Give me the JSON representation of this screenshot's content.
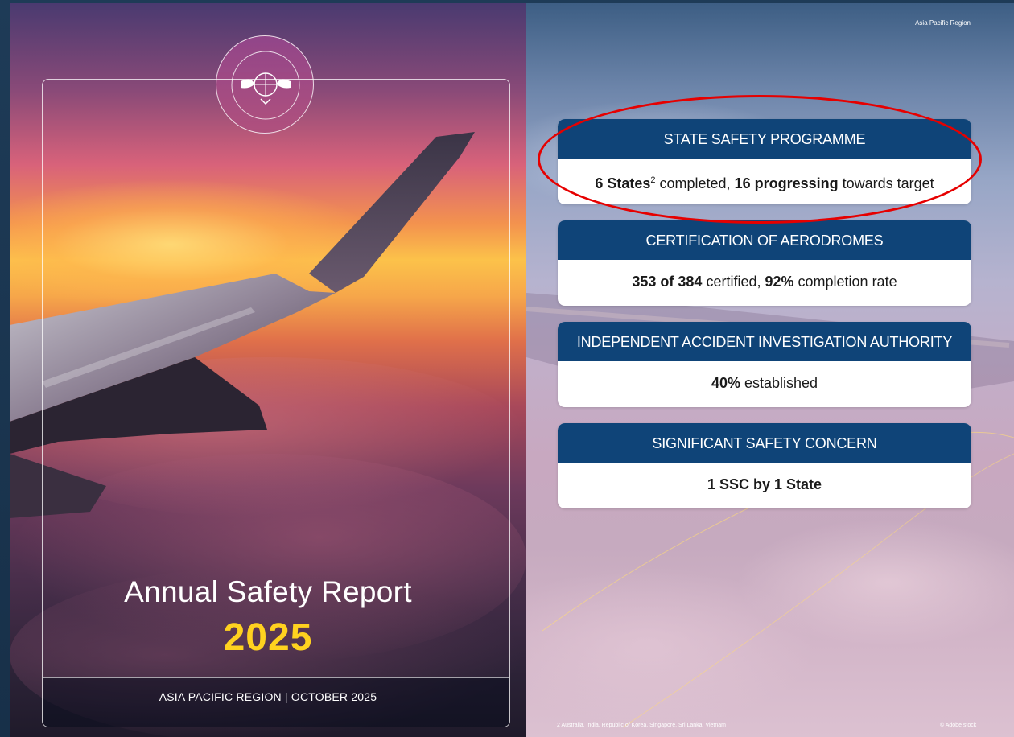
{
  "cover": {
    "logo_text": "ICAO · OACI · ИКАО",
    "title": "Annual Safety Report",
    "year": "2025",
    "subtitle": "ASIA PACIFIC REGION  |  OCTOBER 2025"
  },
  "right_page": {
    "region_tag": "Asia Pacific Region",
    "cards": [
      {
        "heading": "STATE SAFETY PROGRAMME",
        "parts": [
          {
            "text": "6 States",
            "bold": true
          },
          {
            "text": "2",
            "sup": true
          },
          {
            "text": " completed, "
          },
          {
            "text": "16 progressing",
            "bold": true
          },
          {
            "text": " towards target"
          }
        ]
      },
      {
        "heading": "CERTIFICATION OF AERODROMES",
        "parts": [
          {
            "text": "353 of 384",
            "bold": true
          },
          {
            "text": " certified, "
          },
          {
            "text": "92%",
            "bold": true
          },
          {
            "text": " completion rate"
          }
        ]
      },
      {
        "heading": "INDEPENDENT ACCIDENT INVESTIGATION AUTHORITY",
        "parts": [
          {
            "text": "40%",
            "bold": true
          },
          {
            "text": " established"
          }
        ]
      },
      {
        "heading": "SIGNIFICANT SAFETY CONCERN",
        "parts": [
          {
            "text": "1 SSC by 1 State",
            "bold": true
          }
        ]
      }
    ],
    "footnote": "2   Australia, India, Republic of Korea, Singapore, Sri Lanka, Vietnam",
    "credit": "© Adobe stock"
  },
  "colors": {
    "card_header": "#0f4478",
    "year_accent": "#ffd21f",
    "highlight": "#e60000"
  }
}
